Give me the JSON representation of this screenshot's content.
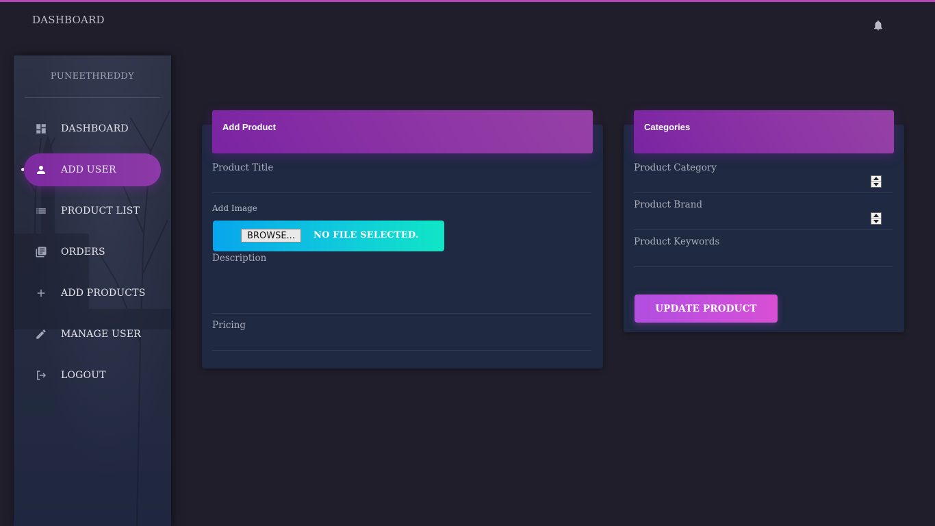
{
  "colors": {
    "background": "#1f1e2a",
    "sidebar": "#2a2f44",
    "card": "#1f2942",
    "accent_purple": "#8531a4",
    "file_gradient_start": "#07a6ec",
    "file_gradient_end": "#10e6c6",
    "button_gradient_start": "#b14ee0",
    "button_gradient_end": "#d84fd4"
  },
  "header": {
    "title": "DASHBOARD",
    "notification_icon": "bell-icon"
  },
  "sidebar": {
    "user_name": "PUNEETHREDDY",
    "items": [
      {
        "label": "DASHBOARD",
        "icon": "dashboard-icon",
        "active": false
      },
      {
        "label": "ADD USER",
        "icon": "person-icon",
        "active": true
      },
      {
        "label": "PRODUCT LIST",
        "icon": "list-icon",
        "active": false
      },
      {
        "label": "ORDERS",
        "icon": "library-books-icon",
        "active": false
      },
      {
        "label": "ADD PRODUCTS",
        "icon": "plus-icon",
        "active": false
      },
      {
        "label": "MANAGE USER",
        "icon": "pencil-icon",
        "active": false
      },
      {
        "label": "LOGOUT",
        "icon": "logout-icon",
        "active": false
      }
    ]
  },
  "add_product": {
    "title": "Add Product",
    "product_title_label": "Product Title",
    "product_title_value": "",
    "add_image_label": "Add Image",
    "browse_label": "BROWSE...",
    "file_status": "NO FILE SELECTED.",
    "description_label": "Description",
    "description_value": "",
    "pricing_label": "Pricing",
    "pricing_value": ""
  },
  "categories": {
    "title": "Categories",
    "category_label": "Product Category",
    "category_value": "",
    "brand_label": "Product Brand",
    "brand_value": "",
    "keywords_label": "Product Keywords",
    "keywords_value": "",
    "update_button": "UPDATE PRODUCT"
  }
}
